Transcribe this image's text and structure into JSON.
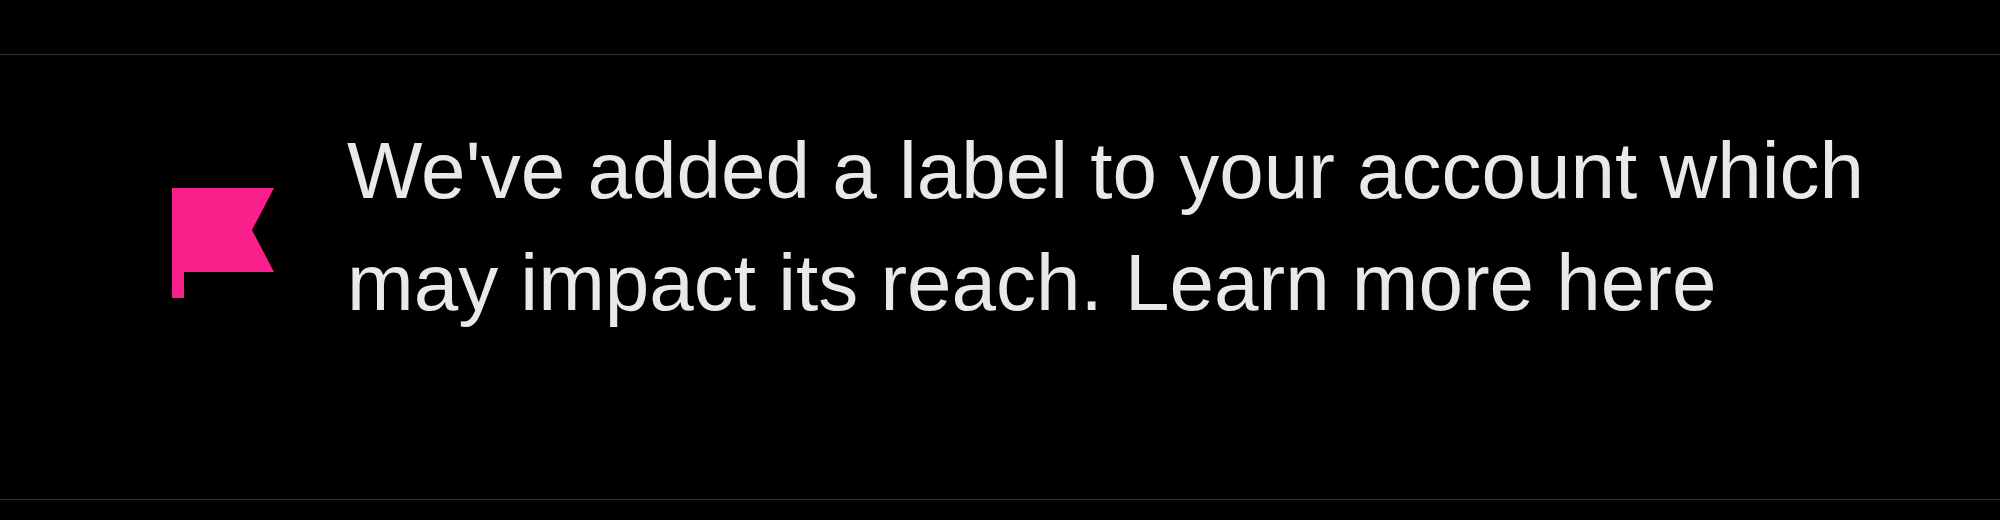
{
  "notice": {
    "text": "We've added a label to your account which may impact its reach. Learn more here"
  }
}
